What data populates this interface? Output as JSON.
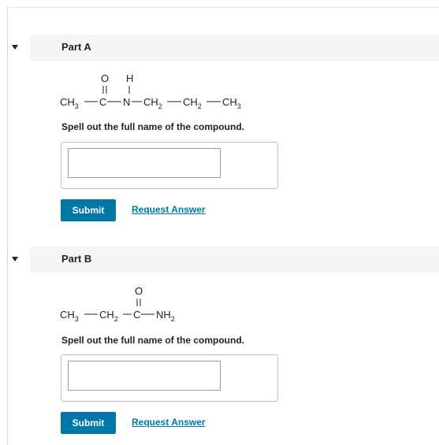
{
  "part_a": {
    "title": "Part A",
    "formula": {
      "ch3": "CH",
      "ch3_sub": "3",
      "carbonyl_o": "O",
      "carbonyl_c": "C",
      "n": "N",
      "h": "H",
      "ch2a": "CH",
      "ch2a_sub": "2",
      "ch2b": "CH",
      "ch2b_sub": "2",
      "ch3_end": "CH",
      "ch3_end_sub": "3"
    },
    "prompt": "Spell out the full name of the compound.",
    "answer_value": "",
    "submit_label": "Submit",
    "request_label": "Request Answer"
  },
  "part_b": {
    "title": "Part B",
    "formula": {
      "ch3": "CH",
      "ch3_sub": "3",
      "ch2": "CH",
      "ch2_sub": "2",
      "carbonyl_o": "O",
      "carbonyl_c": "C",
      "nh2": "NH",
      "nh2_sub": "2"
    },
    "prompt": "Spell out the full name of the compound.",
    "answer_value": "",
    "submit_label": "Submit",
    "request_label": "Request Answer"
  },
  "colors": {
    "accent": "#0077a7",
    "header_bg": "#f5f5f5"
  },
  "icons": {
    "toggle": "caret-down-icon"
  }
}
